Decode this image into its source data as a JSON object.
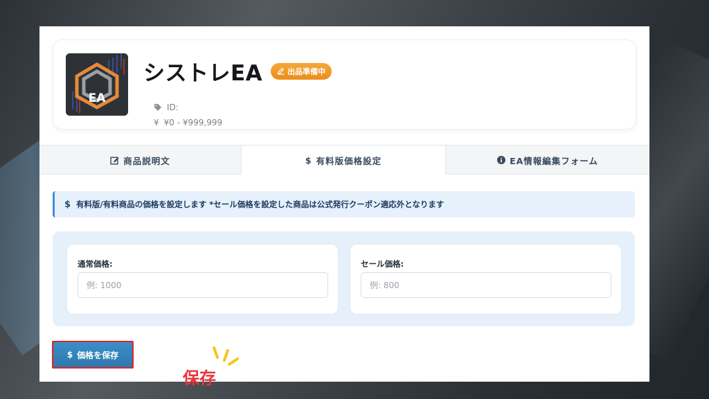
{
  "product": {
    "title": "シストレEA",
    "status_badge": "出品準備中",
    "id_label": "ID:",
    "price_range": "¥0 - ¥999,999",
    "thumbnail_text": "EA"
  },
  "tabs": [
    {
      "label": "商品説明文",
      "icon": "edit-icon",
      "active": false
    },
    {
      "label": "有料版価格設定",
      "icon": "dollar-icon",
      "active": true
    },
    {
      "label": "EA情報編集フォーム",
      "icon": "info-icon",
      "active": false
    }
  ],
  "info": {
    "icon": "$",
    "text": "有料版/有料商品の価格を設定します *セール価格を設定した商品は公式発行クーポン適応外となります"
  },
  "fields": {
    "regular": {
      "label": "通常価格:",
      "placeholder": "例: 1000",
      "value": ""
    },
    "sale": {
      "label": "セール価格:",
      "placeholder": "例: 800",
      "value": ""
    }
  },
  "save_button": {
    "icon": "$",
    "label": "価格を保存"
  },
  "annotation": {
    "text": "保存"
  },
  "colors": {
    "accent": "#2f78ad",
    "badge": "#ea8d1a",
    "highlight": "#e02424",
    "annotation": "#e8343b"
  }
}
